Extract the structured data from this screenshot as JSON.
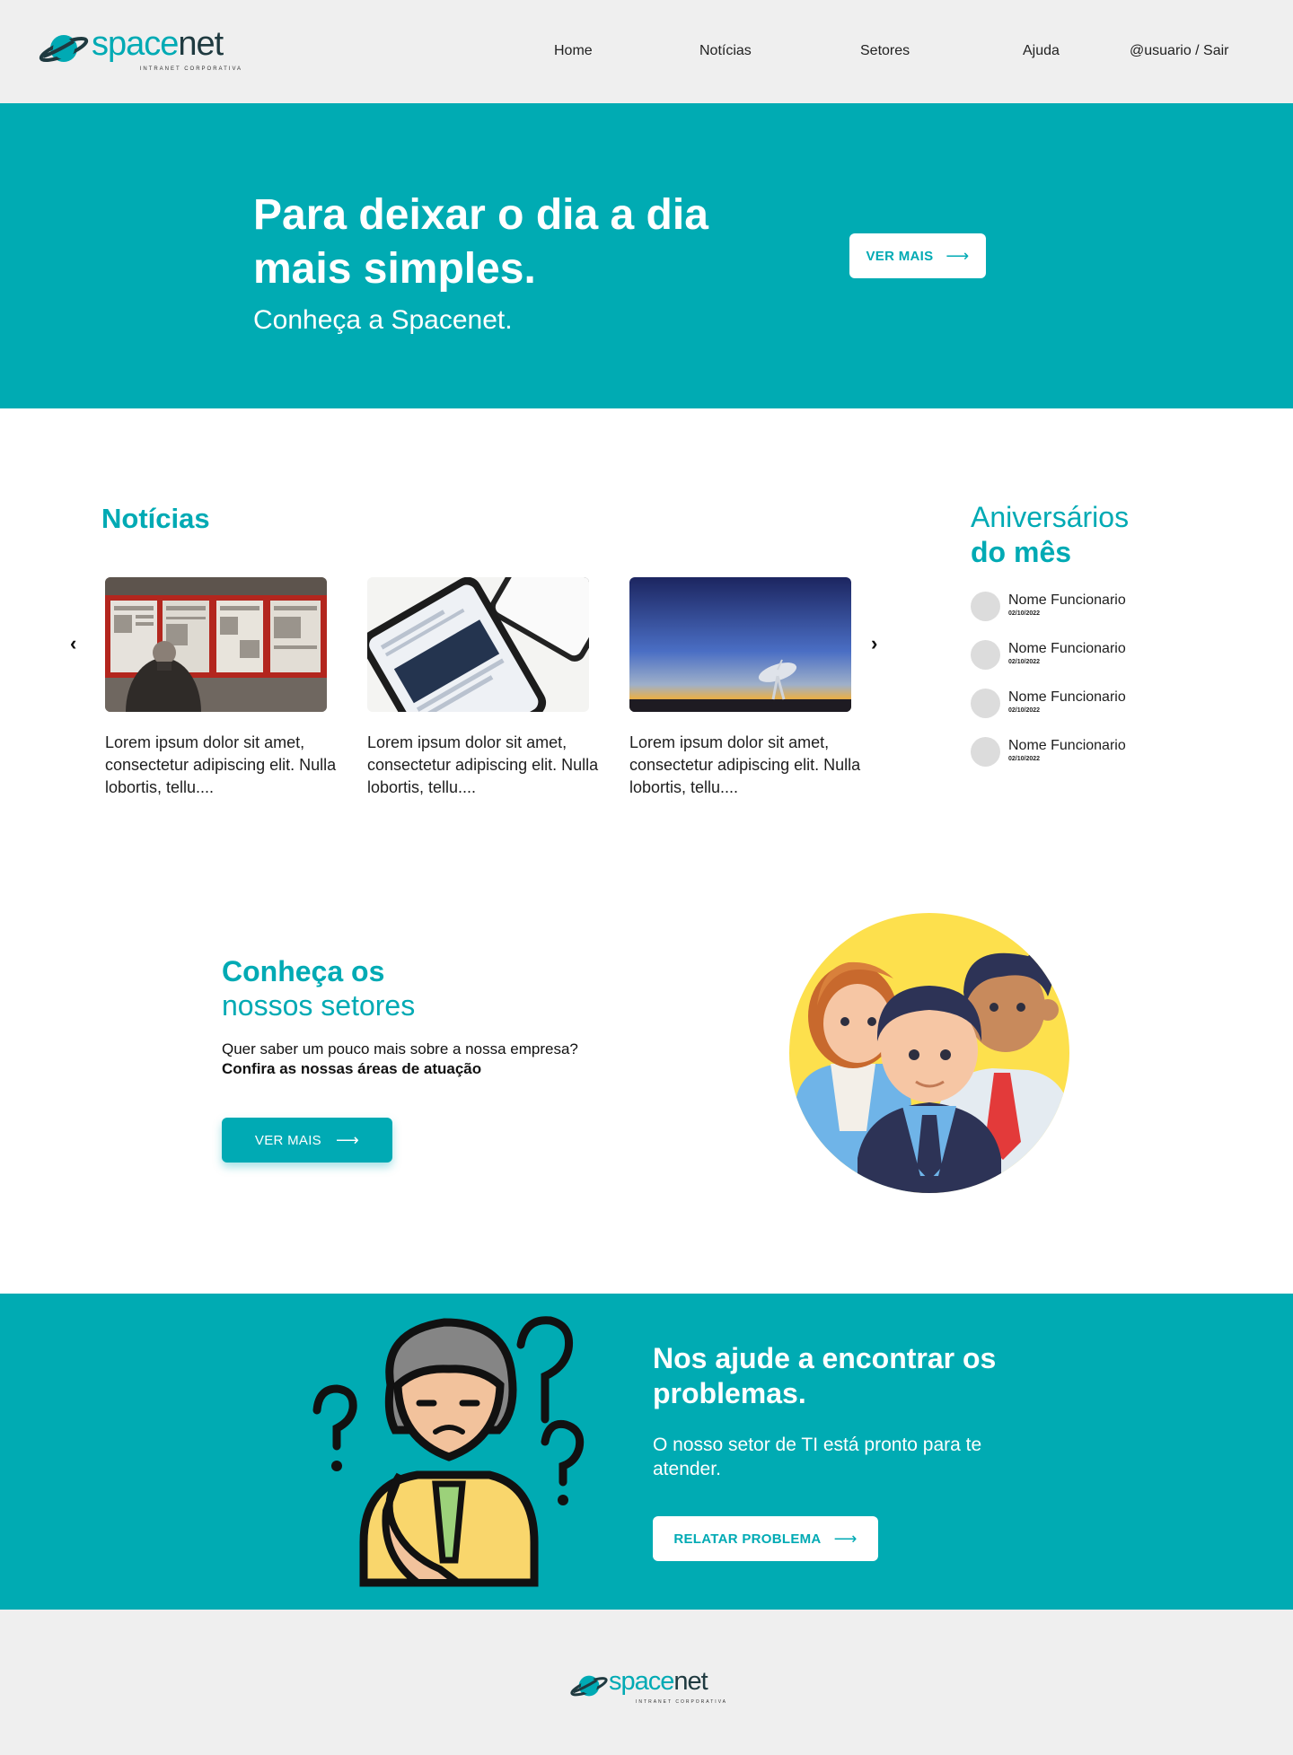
{
  "brand": {
    "name_a": "space",
    "name_b": "net",
    "tagline": "INTRANET CORPORATIVA"
  },
  "nav": {
    "home": "Home",
    "news": "Notícias",
    "sectors": "Setores",
    "help": "Ajuda",
    "user": "@usuario / Sair"
  },
  "hero": {
    "title": "Para deixar o dia a dia mais simples.",
    "subtitle": "Conheça a Spacenet.",
    "button": "VER MAIS"
  },
  "news": {
    "title": "Notícias",
    "items": [
      {
        "image": "newspaper-wall-photo",
        "text": "Lorem ipsum dolor sit amet, consectetur adipiscing elit. Nulla lobortis, tellu...."
      },
      {
        "image": "phone-news-app-photo",
        "text": "Lorem ipsum dolor sit amet, consectetur adipiscing elit. Nulla lobortis, tellu...."
      },
      {
        "image": "radio-telescope-sunset-photo",
        "text": "Lorem ipsum dolor sit amet, consectetur adipiscing elit. Nulla lobortis, tellu...."
      }
    ]
  },
  "birthdays": {
    "title_line1": "Aniversários",
    "title_line2": "do mês",
    "items": [
      {
        "name": "Nome Funcionario",
        "date": "02/10/2022"
      },
      {
        "name": "Nome Funcionario",
        "date": "02/10/2022"
      },
      {
        "name": "Nome Funcionario",
        "date": "02/10/2022"
      },
      {
        "name": "Nome Funcionario",
        "date": "02/10/2022"
      }
    ]
  },
  "sectors": {
    "title_line1": "Conheça os",
    "title_line2": "nossos setores",
    "desc_line1": "Quer saber um pouco mais sobre a nossa empresa?",
    "desc_line2": "Confira as nossas áreas de atuação",
    "button": "VER MAIS"
  },
  "help": {
    "title": "Nos ajude a encontrar os problemas.",
    "subtitle": "O nosso setor de TI está pronto para te atender.",
    "button": "RELATAR PROBLEMA"
  },
  "colors": {
    "accent": "#00aab4",
    "header_bg": "#efefef"
  }
}
